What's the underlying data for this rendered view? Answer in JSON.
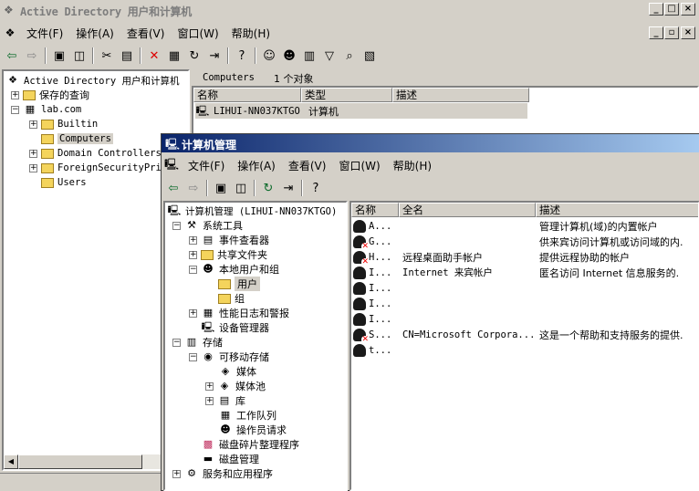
{
  "back_window": {
    "title": "Active Directory 用户和计算机",
    "menu": [
      "文件(F)",
      "操作(A)",
      "查看(V)",
      "窗口(W)",
      "帮助(H)"
    ],
    "tree": {
      "root": "Active Directory 用户和计算机",
      "saved_queries": "保存的查询",
      "domain": "lab.com",
      "children": [
        "Builtin",
        "Computers",
        "Domain Controllers",
        "ForeignSecurityPri",
        "Users"
      ],
      "selected": "Computers"
    },
    "detail_header": {
      "container": "Computers",
      "count_text": "1 个对象"
    },
    "columns": [
      "名称",
      "类型",
      "描述"
    ],
    "rows": [
      {
        "name": "LIHUI-NN037KTGO",
        "type": "计算机",
        "desc": ""
      }
    ]
  },
  "front_window": {
    "title": "计算机管理",
    "menu": [
      "文件(F)",
      "操作(A)",
      "查看(V)",
      "窗口(W)",
      "帮助(H)"
    ],
    "tree": {
      "root": "计算机管理 (LIHUI-NN037KTGO)",
      "system_tools": "系统工具",
      "event_viewer": "事件查看器",
      "shared_folders": "共享文件夹",
      "local_users": "本地用户和组",
      "users": "用户",
      "groups": "组",
      "perf_logs": "性能日志和警报",
      "device_manager": "设备管理器",
      "storage": "存储",
      "removable": "可移动存储",
      "media": "媒体",
      "media_pool": "媒体池",
      "library": "库",
      "work_queue": "工作队列",
      "operator_requests": "操作员请求",
      "defrag": "磁盘碎片整理程序",
      "disk_mgmt": "磁盘管理",
      "services_apps": "服务和应用程序",
      "selected": "用户"
    },
    "columns": [
      "名称",
      "全名",
      "描述"
    ],
    "users": [
      {
        "name": "A...",
        "full": "",
        "desc": "管理计算机(域)的内置帐户",
        "disabled": false
      },
      {
        "name": "G...",
        "full": "",
        "desc": "供来宾访问计算机或访问域的内.",
        "disabled": false
      },
      {
        "name": "H...",
        "full": "远程桌面助手帐户",
        "desc": "提供远程协助的帐户",
        "disabled": true
      },
      {
        "name": "I...",
        "full": "Internet 来宾帐户",
        "desc": "匿名访问 Internet 信息服务的.",
        "disabled": false
      },
      {
        "name": "I...",
        "full": "",
        "desc": "",
        "disabled": false
      },
      {
        "name": "I...",
        "full": "",
        "desc": "",
        "disabled": false
      },
      {
        "name": "I...",
        "full": "",
        "desc": "",
        "disabled": false
      },
      {
        "name": "S...",
        "full": "CN=Microsoft Corpora...",
        "desc": "这是一个帮助和支持服务的提供.",
        "disabled": true
      },
      {
        "name": "t...",
        "full": "",
        "desc": "",
        "disabled": false
      }
    ]
  },
  "icons": {
    "back": "back-arrow-icon",
    "forward": "forward-arrow-icon",
    "up": "up-folder-icon",
    "cut": "scissors-icon",
    "delete": "delete-x-icon",
    "filter": "filter-icon",
    "help": "help-icon"
  },
  "colors": {
    "title_active": "#0a246a",
    "selection": "#d4d0c8",
    "folder": "#f4d45c"
  }
}
